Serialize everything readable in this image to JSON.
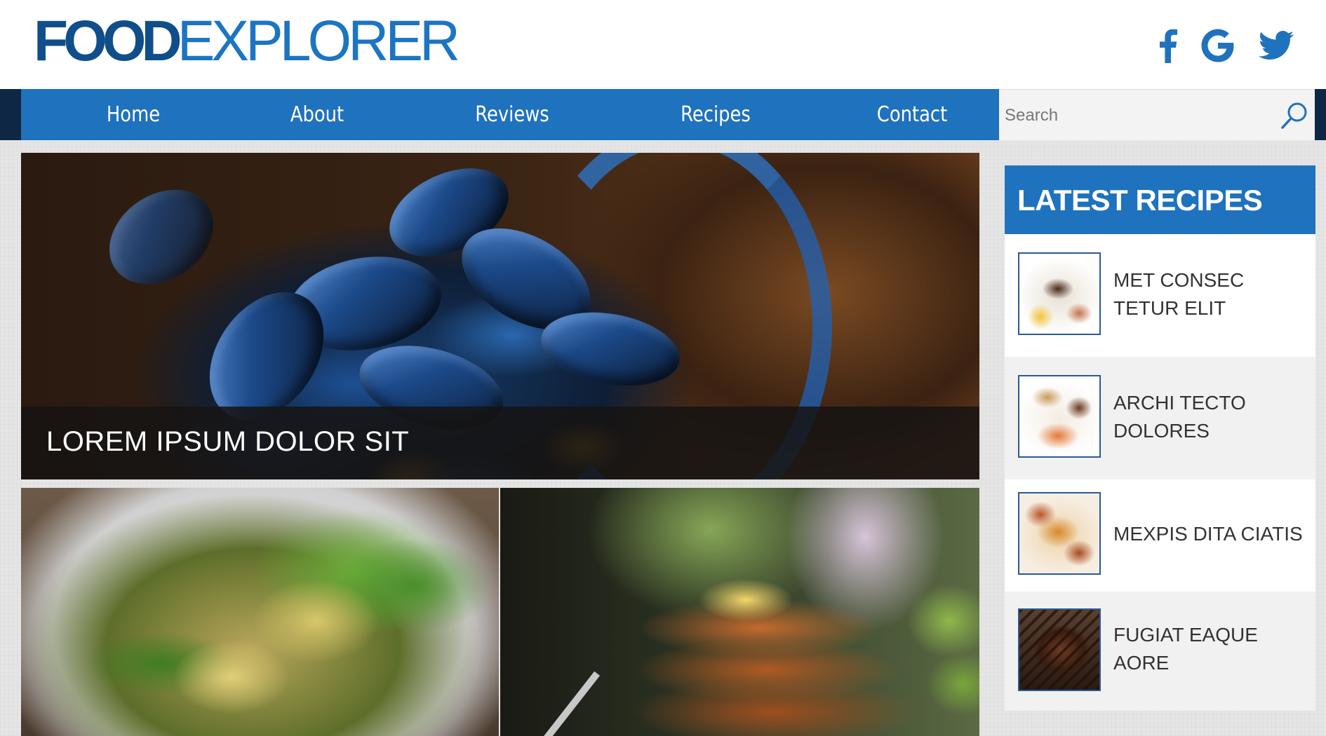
{
  "brand": {
    "logo_bold": "FOOD",
    "logo_light": "EXPLORER"
  },
  "social": [
    "facebook-icon",
    "google-icon",
    "twitter-icon"
  ],
  "nav": {
    "items": [
      {
        "label": "Home"
      },
      {
        "label": "About"
      },
      {
        "label": "Reviews"
      },
      {
        "label": "Recipes"
      },
      {
        "label": "Contact"
      }
    ]
  },
  "search": {
    "placeholder": "Search",
    "value": ""
  },
  "hero": {
    "caption": "LOREM IPSUM DOLOR SIT"
  },
  "sidebar": {
    "title": "LATEST RECIPES",
    "items": [
      {
        "title": "MET CONSEC TETUR ELIT"
      },
      {
        "title": "ARCHI TECTO DOLORES"
      },
      {
        "title": "MEXPIS DITA CIATIS"
      },
      {
        "title": "FUGIAT EAQUE AORE"
      }
    ]
  },
  "colors": {
    "brand_blue": "#1f72bd",
    "dark_navy": "#0e2745",
    "logo_dark": "#0f4e8a"
  }
}
